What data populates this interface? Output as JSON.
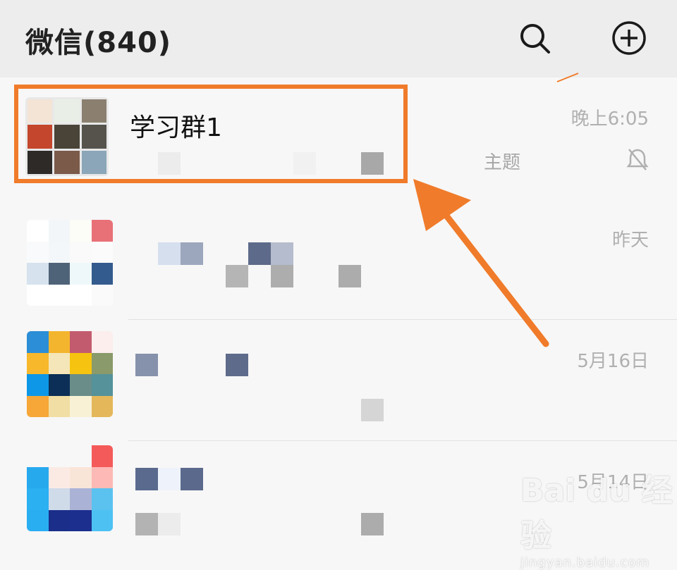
{
  "header": {
    "title": "微信(840)",
    "search_icon": "search-icon",
    "add_icon": "plus-circle-icon"
  },
  "chats": [
    {
      "name": "学习群1",
      "time": "晚上6:05",
      "subtitle": "主题",
      "muted": true,
      "avatar": "group-avatar"
    },
    {
      "name": "",
      "time": "昨天",
      "subtitle": "",
      "muted": false,
      "avatar": "blurred-avatar"
    },
    {
      "name": "",
      "time": "5月16日",
      "subtitle": "",
      "muted": false,
      "avatar": "blurred-avatar"
    },
    {
      "name": "",
      "time": "5月14日",
      "subtitle": "",
      "muted": false,
      "avatar": "blurred-avatar"
    }
  ],
  "annotation": {
    "box_color": "#f07b2a",
    "arrow_color": "#f07b2a"
  },
  "watermark": {
    "brand": "Bai du 经验",
    "url": "jingyan.baidu.com"
  }
}
